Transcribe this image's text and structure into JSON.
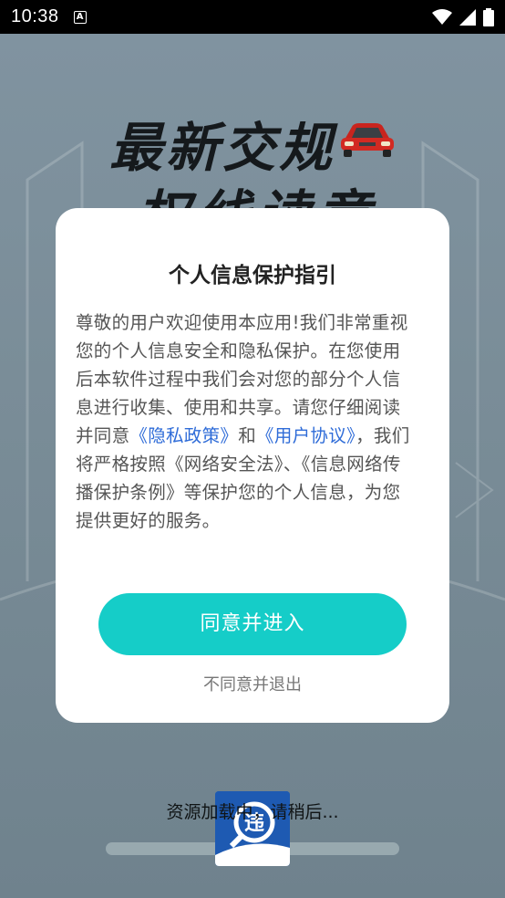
{
  "status_bar": {
    "time": "10:38",
    "notification_glyph": "A"
  },
  "splash": {
    "title_line1": "最新交规",
    "title_line2": "权线读章",
    "loading_text": "资源加载中，请稍后..."
  },
  "dialog": {
    "title": "个人信息保护指引",
    "body_part1": "尊敬的用户欢迎使用本应用!我们非常重视您的个人信息安全和隐私保护。在您使用后本软件过程中我们会对您的部分个人信息进行收集、使用和共享。请您仔细阅读并同意",
    "privacy_link": "《隐私政策》",
    "body_and": "和",
    "terms_link": "《用户协议》",
    "body_part2": "，我们将严格按照《网络安全法》、《信息网络传播保护条例》等保护您的个人信息，为您提供更好的服务。",
    "agree_button": "同意并进入",
    "disagree_button": "不同意并退出"
  },
  "colors": {
    "accent": "#15cdc8",
    "link": "#2f6cd8",
    "overlay": "#7b8d95",
    "app_logo": "#1e5ab2"
  }
}
